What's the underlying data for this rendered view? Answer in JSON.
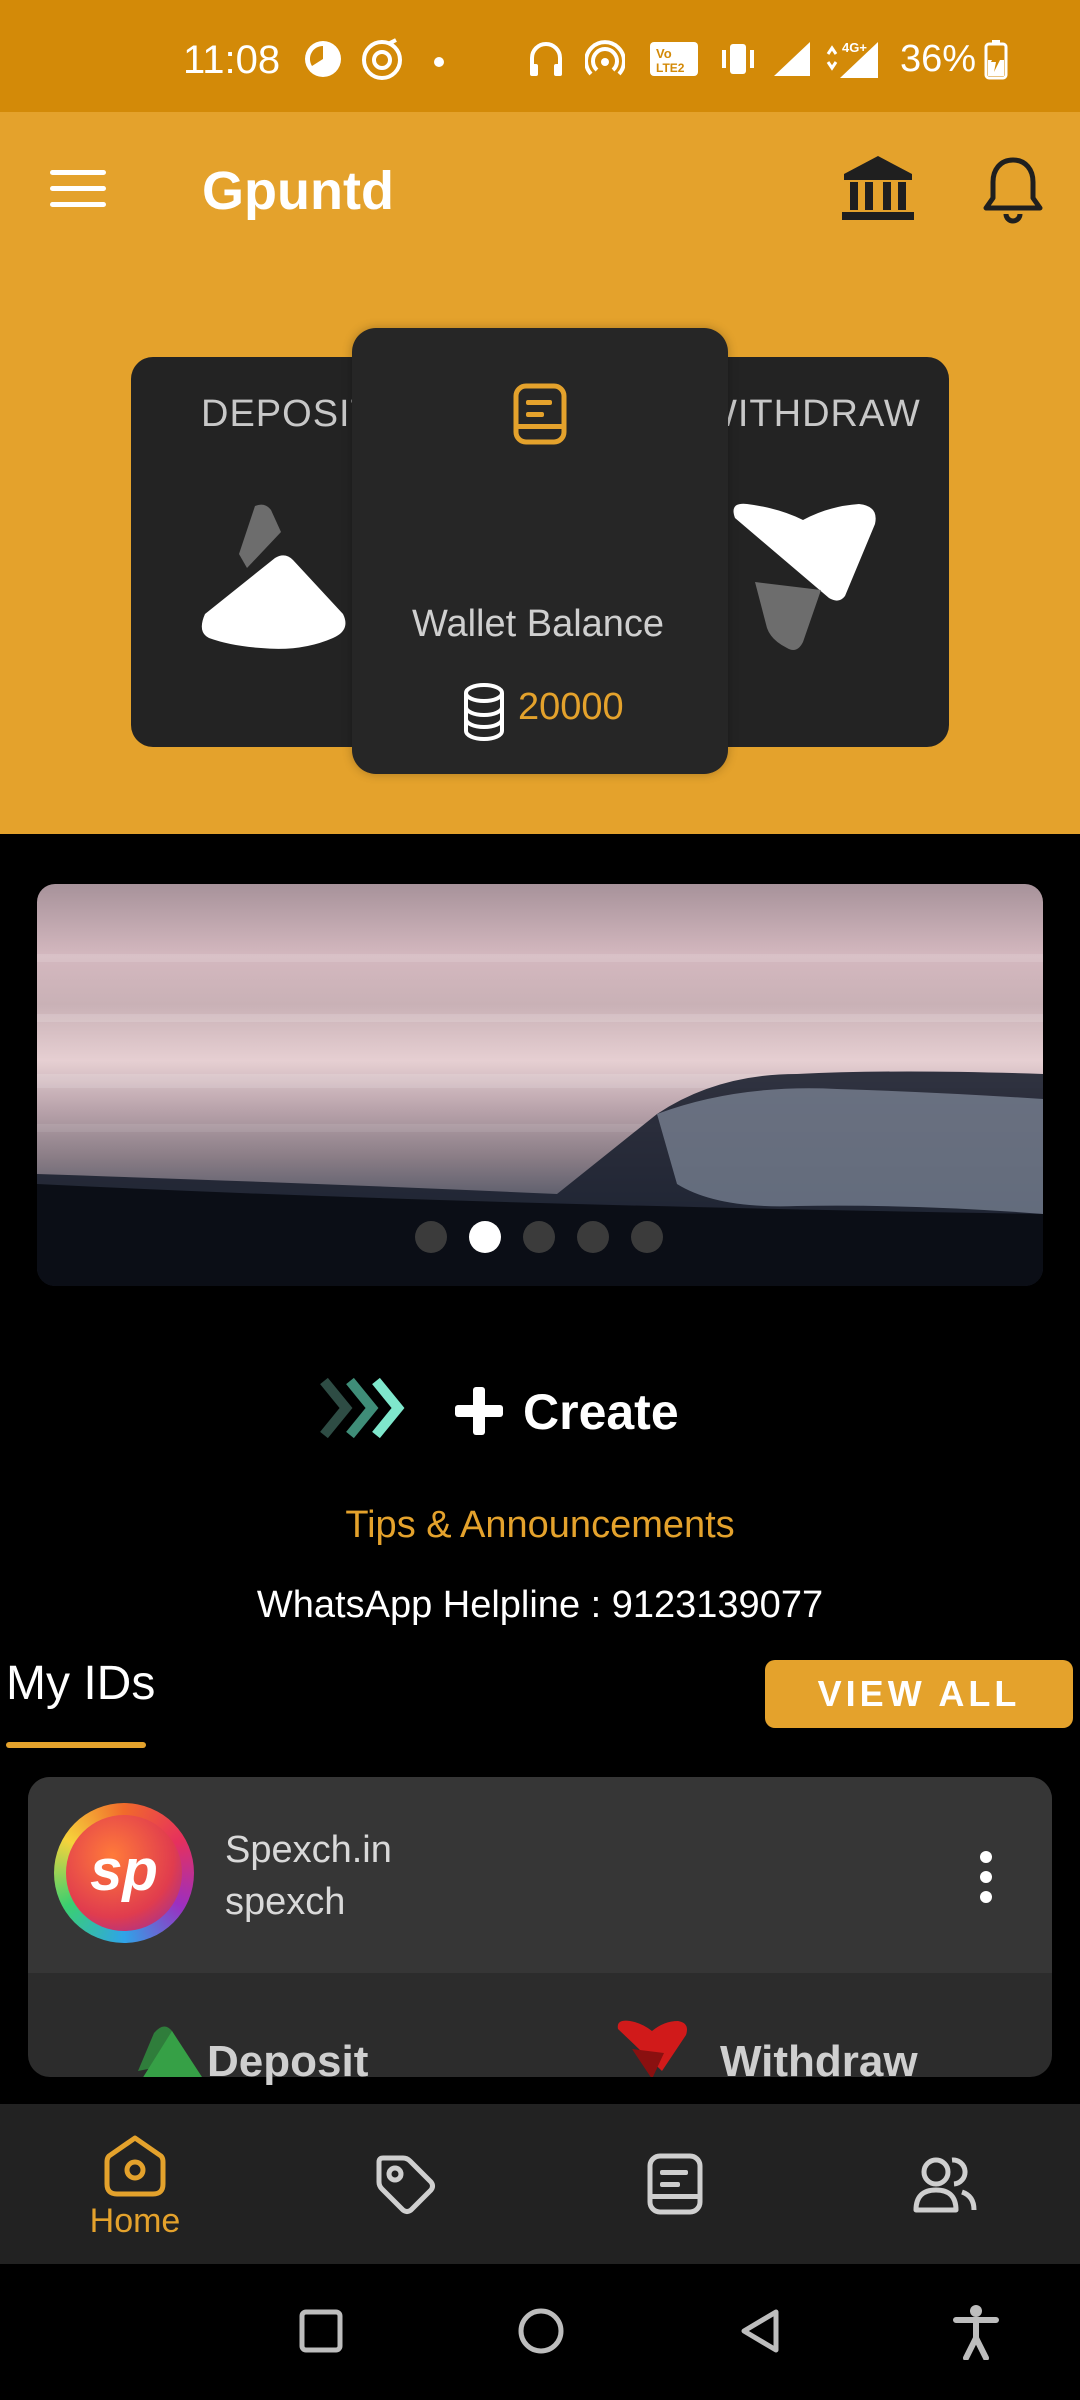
{
  "status_bar": {
    "time": "11:08",
    "battery": "36%"
  },
  "header": {
    "title": "Gpuntd",
    "icons": [
      "menu-icon",
      "bank-icon",
      "bell-icon"
    ]
  },
  "cards": {
    "deposit_label": "DEPOSIT",
    "withdraw_label": "WITHDRAW",
    "wallet_label": "Wallet Balance",
    "wallet_amount": "20000"
  },
  "banner": {
    "slides": 5,
    "active_slide": 2
  },
  "create": {
    "label": "Create"
  },
  "tips_label": "Tips & Announcements",
  "helpline": "WhatsApp Helpline : 9123139077",
  "my_ids": {
    "title": "My IDs",
    "view_all_label": "VIEW ALL",
    "items": [
      {
        "avatar_text": "sp",
        "site": "Spexch.in",
        "username": "spexch",
        "deposit_label": "Deposit",
        "withdraw_label": "Withdraw"
      }
    ]
  },
  "bottom_nav": {
    "items": [
      {
        "label": "Home",
        "icon": "home-icon",
        "active": true
      },
      {
        "label": "",
        "icon": "tag-icon",
        "active": false
      },
      {
        "label": "",
        "icon": "document-icon",
        "active": false
      },
      {
        "label": "",
        "icon": "users-icon",
        "active": false
      }
    ]
  },
  "colors": {
    "accent": "#e4a22c",
    "status_bar": "#d38a08",
    "card": "#232323",
    "background": "#000000"
  }
}
